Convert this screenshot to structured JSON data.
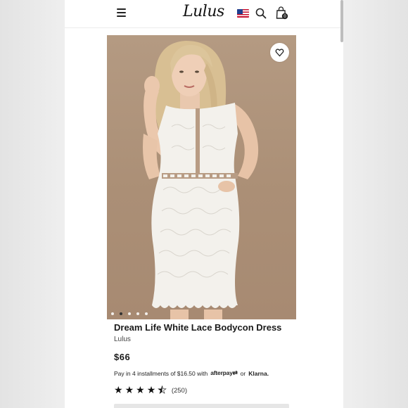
{
  "header": {
    "logo_text": "Lulus",
    "menu_icon": "hamburger-menu-icon",
    "flag_icon": "us-flag-icon",
    "search_icon": "search-icon",
    "bag_icon": "shopping-bag-icon",
    "bag_count": "0"
  },
  "gallery": {
    "image_description_icon": "dress-photo",
    "wishlist_icon": "heart-icon",
    "dot_count": 5,
    "active_dot": 1
  },
  "product": {
    "title": "Dream Life White Lace Bodycon Dress",
    "brand": "Lulus",
    "price": "$66",
    "installments_text": "Pay in 4 installments of $16.50 with",
    "afterpay_label": "afterpay",
    "or_text": "or",
    "klarna_label": "Klarna.",
    "rating_value": 4.5,
    "review_count": "(250)"
  },
  "colors": {
    "photo_background": "#ad9178",
    "text_primary": "#1a1a1a",
    "page_background": "#ffffff"
  }
}
